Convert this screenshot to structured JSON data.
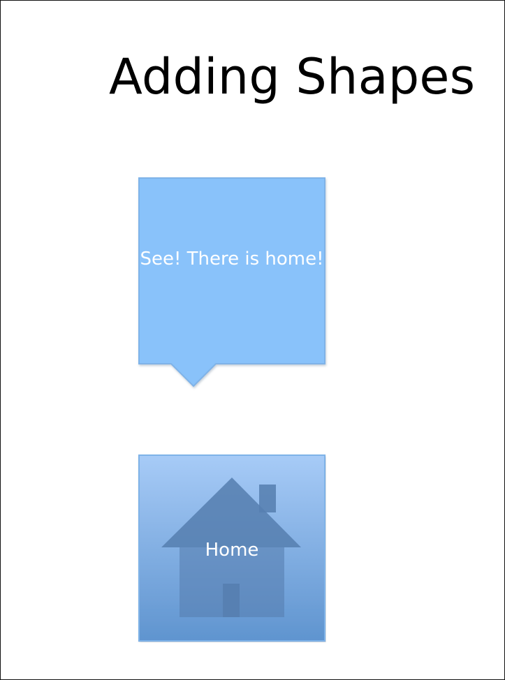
{
  "slide": {
    "title": "Adding Shapes",
    "callout": {
      "text": "See! There is home!",
      "fill": "#89c2fa",
      "border": "#7fb3e8"
    },
    "home_shape": {
      "label": "Home",
      "fill_top": "#9cc6f7",
      "fill_bottom": "#5d95d2",
      "house_color": "#567fb1"
    }
  }
}
